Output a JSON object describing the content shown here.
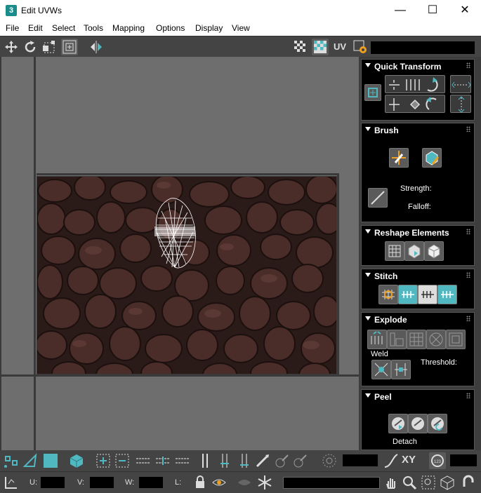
{
  "window": {
    "app_icon": "3",
    "title": "Edit UVWs",
    "controls": {
      "minimize": "—",
      "maximize": "☐",
      "close": "✕"
    }
  },
  "menu": [
    "File",
    "Edit",
    "Select",
    "Tools",
    "Mapping",
    "Options",
    "Display",
    "View"
  ],
  "toolbar_top": {
    "uv_label": "UV",
    "tools": [
      "move-icon",
      "rotate-icon",
      "freeform-icon",
      "scale-icon",
      "mirror-icon",
      "checker-icon",
      "checker-active-icon",
      "settings-icon"
    ]
  },
  "panel": {
    "quick_transform": {
      "title": "Quick Transform"
    },
    "brush": {
      "title": "Brush",
      "strength_label": "Strength:",
      "falloff_label": "Falloff:"
    },
    "reshape": {
      "title": "Reshape Elements"
    },
    "stitch": {
      "title": "Stitch"
    },
    "explode": {
      "title": "Explode",
      "weld_label": "Weld",
      "threshold_label": "Threshold:"
    },
    "peel": {
      "title": "Peel",
      "detach_label": "Detach"
    }
  },
  "bottom": {
    "xy_label": "XY",
    "u_label": "U:",
    "v_label": "V:",
    "w_label": "W:",
    "l_label": "L:"
  },
  "colors": {
    "accent_teal": "#4fb8c0",
    "viewport_bg": "#6e6e6e",
    "toolbar_bg": "#444444",
    "panel_bg": "#000000"
  }
}
